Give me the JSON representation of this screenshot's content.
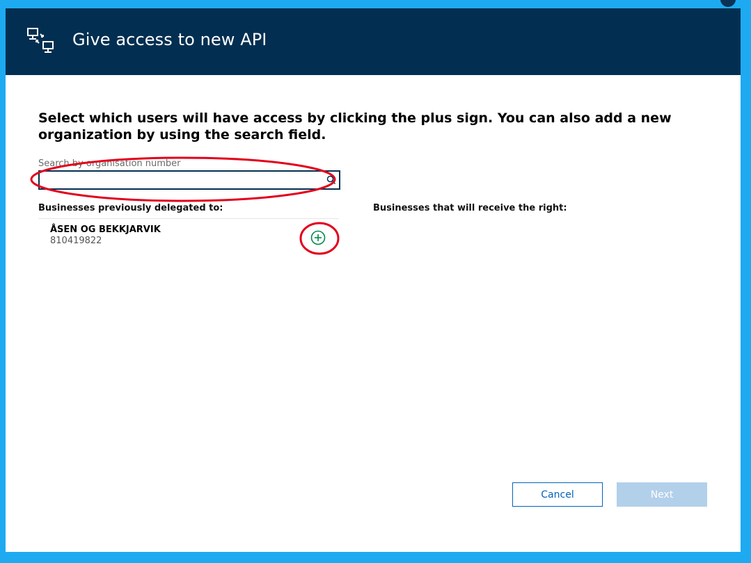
{
  "dialog": {
    "title": "Give access to new API",
    "icon": "api-delegation-icon",
    "instructions": "Select which users will have access by clicking the plus sign. You can also add a new organization by using the search field."
  },
  "search": {
    "label": "Search by organisation number",
    "value": "",
    "placeholder": "",
    "icon": "search-icon"
  },
  "left_column": {
    "heading": "Businesses previously delegated to:",
    "items": [
      {
        "name": "ÅSEN OG BEKKJARVIK",
        "number": "810419822",
        "action_icon": "add-circle-icon"
      }
    ]
  },
  "right_column": {
    "heading": "Businesses that will receive the right:",
    "items": []
  },
  "buttons": {
    "cancel": "Cancel",
    "next": "Next"
  },
  "colors": {
    "page_background": "#1eaaf1",
    "header_background": "#022f51",
    "accent_blue": "#0062ba",
    "add_green": "#008949",
    "next_disabled": "#b3d0ea",
    "annotation_red": "#e3001b"
  }
}
